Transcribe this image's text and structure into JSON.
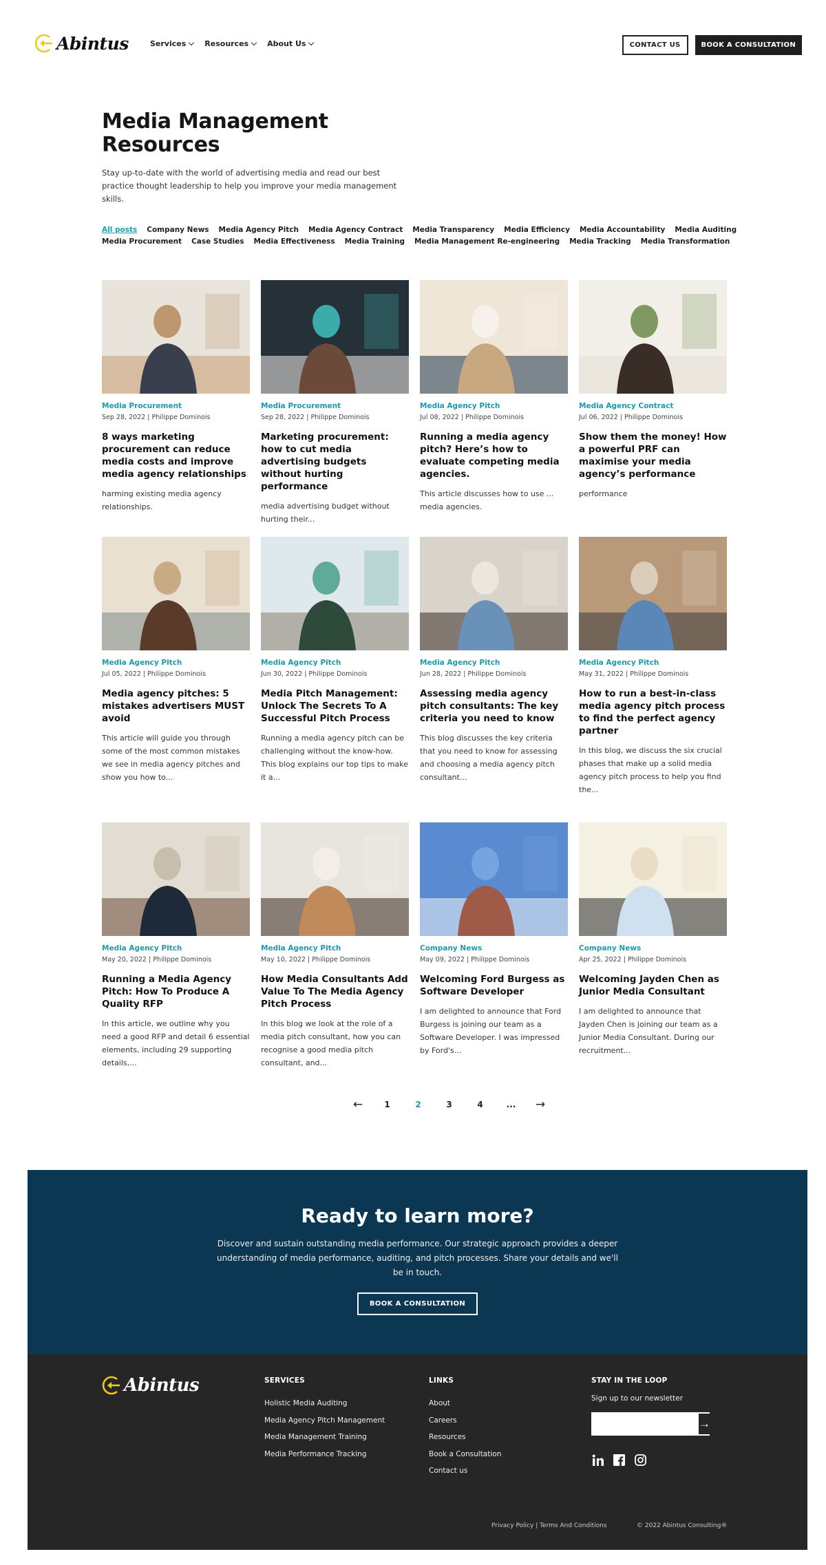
{
  "header": {
    "logo_text": "Abintus",
    "nav": [
      {
        "label": "Services"
      },
      {
        "label": "Resources"
      },
      {
        "label": "About Us"
      }
    ],
    "contact_label": "CONTACT US",
    "book_label": "BOOK A CONSULTATION"
  },
  "hero": {
    "title_line1": "Media Management",
    "title_line2": "Resources",
    "description": "Stay up-to-date with the world of advertising media and read our best practice thought leadership to help you improve your media management skills."
  },
  "filters": [
    {
      "label": "All posts",
      "active": true
    },
    {
      "label": "Company News"
    },
    {
      "label": "Media Agency Pitch"
    },
    {
      "label": "Media Agency Contract"
    },
    {
      "label": "Media Transparency"
    },
    {
      "label": "Media Efficiency"
    },
    {
      "label": "Media Accountability"
    },
    {
      "label": "Media Auditing"
    },
    {
      "label": "Media Procurement"
    },
    {
      "label": "Case Studies"
    },
    {
      "label": "Media Effectiveness"
    },
    {
      "label": "Media Training"
    },
    {
      "label": "Media Management Re-engineering"
    },
    {
      "label": "Media Tracking"
    },
    {
      "label": "Media Transformation"
    }
  ],
  "posts": [
    {
      "category": "Media Procurement",
      "meta": "Sep 28, 2022 | Philippe Dominois",
      "title": "8 ways marketing procurement can reduce media costs and improve media agency relationships",
      "excerpt": "harming existing media agency relationships.",
      "image": "business-meeting-handshake"
    },
    {
      "category": "Media Procurement",
      "meta": "Sep 28, 2022 | Philippe Dominois",
      "title": "Marketing procurement: how to cut media advertising budgets without hurting performance",
      "excerpt": "media advertising budget without hurting their...",
      "image": "woman-at-laptop"
    },
    {
      "category": "Media Agency Pitch",
      "meta": "Jul 08, 2022 | Philippe Dominois",
      "title": "Running a media agency pitch? Here’s how to evaluate competing media agencies.",
      "excerpt": "This article discusses how to use ... media agencies.",
      "image": "hands-on-tablets"
    },
    {
      "category": "Media Agency Contract",
      "meta": "Jul 06, 2022 | Philippe Dominois",
      "title": "Show them the money! How a powerful PRF can maximise your media agency’s performance",
      "excerpt": "performance",
      "image": "woman-reading-documents"
    },
    {
      "category": "Media Agency Pitch",
      "meta": "Jul 05, 2022 | Philippe Dominois",
      "title": "Media agency pitches: 5 mistakes advertisers MUST avoid",
      "excerpt": "This article will guide you through some of the most common mistakes we see in media agency pitches and show you how to...",
      "image": "woman-curly-hair"
    },
    {
      "category": "Media Agency Pitch",
      "meta": "Jun 30, 2022 | Philippe Dominois",
      "title": "Media Pitch Management: Unlock The Secrets To A Successful Pitch Process",
      "excerpt": "Running a media agency pitch can be challenging without the know-how. This blog explains our top tips to make it a...",
      "image": "office-team-discussion"
    },
    {
      "category": "Media Agency Pitch",
      "meta": "Jun 28, 2022 | Philippe Dominois",
      "title": "Assessing media agency pitch consultants: The key criteria you need to know",
      "excerpt": "This blog discusses the key criteria that you need to know for assessing and choosing a media agency pitch consultant...",
      "image": "colleagues-smiling-at-laptop"
    },
    {
      "category": "Media Agency Pitch",
      "meta": "May 31, 2022 | Philippe Dominois",
      "title": "How to run a best-in-class media agency pitch process to find the perfect agency partner",
      "excerpt": "In this blog, we discuss the six crucial phases that make up a solid media agency pitch process to help you find the...",
      "image": "handshake-smiling-man"
    },
    {
      "category": "Media Agency Pitch",
      "meta": "May 20, 2022 | Philippe Dominois",
      "title": "Running a Media Agency Pitch: How To Produce A Quality RFP",
      "excerpt": "In this article, we outline why you need a good RFP and detail 6 essential elements, including 29 supporting details,...",
      "image": "woman-typing-laptop"
    },
    {
      "category": "Media Agency Pitch",
      "meta": "May 10, 2022 | Philippe Dominois",
      "title": "How Media Consultants Add Value To The Media Agency Pitch Process",
      "excerpt": "In this blog we look at the role of a media pitch consultant, how you can recognise a good media pitch consultant, and...",
      "image": "consultant-meeting"
    },
    {
      "category": "Company News",
      "meta": "May 09, 2022 | Philippe Dominois",
      "title": "Welcoming Ford Burgess as Software Developer",
      "excerpt": "I am delighted to announce that Ford Burgess is joining our team as a Software Developer. I was impressed by Ford's...",
      "image": "portrait-ford-burgess"
    },
    {
      "category": "Company News",
      "meta": "Apr 25, 2022 | Philippe Dominois",
      "title": "Welcoming Jayden Chen as Junior Media Consultant",
      "excerpt": "I am delighted to announce that Jayden Chen is joining our team as a Junior Media Consultant. During our recruitment...",
      "image": "portrait-jayden-chen"
    }
  ],
  "pagination": {
    "prev": "←",
    "next": "→",
    "pages": [
      "1",
      "2",
      "3",
      "4",
      "..."
    ],
    "current": "2"
  },
  "cta": {
    "title": "Ready to learn more?",
    "text": "Discover and sustain outstanding media performance. Our strategic approach provides a deeper understanding of media performance, auditing, and pitch processes. Share your details and we'll be in touch.",
    "button": "BOOK A CONSULTATION"
  },
  "footer": {
    "logo_text": "Abintus",
    "services_heading": "SERVICES",
    "services": [
      "Holistic Media Auditing",
      "Media Agency Pitch Management",
      "Media Management Training",
      "Media Performance Tracking"
    ],
    "links_heading": "LINKS",
    "links": [
      "About",
      "Careers",
      "Resources",
      "Book a Consultation",
      "Contact us"
    ],
    "newsletter_heading": "STAY IN THE LOOP",
    "newsletter_text": "Sign up to our newsletter",
    "newsletter_placeholder": "",
    "socials": [
      "linkedin-icon",
      "facebook-icon",
      "instagram-icon"
    ],
    "legal": "Privacy Policy | Terms And Conditions",
    "copyright": "© 2022 Abintus Consulting®"
  },
  "colors": {
    "accent": "#1d9aac",
    "cta_bg": "#0b3752",
    "footer_bg": "#262626",
    "logo_yellow": "#f2c81b"
  }
}
